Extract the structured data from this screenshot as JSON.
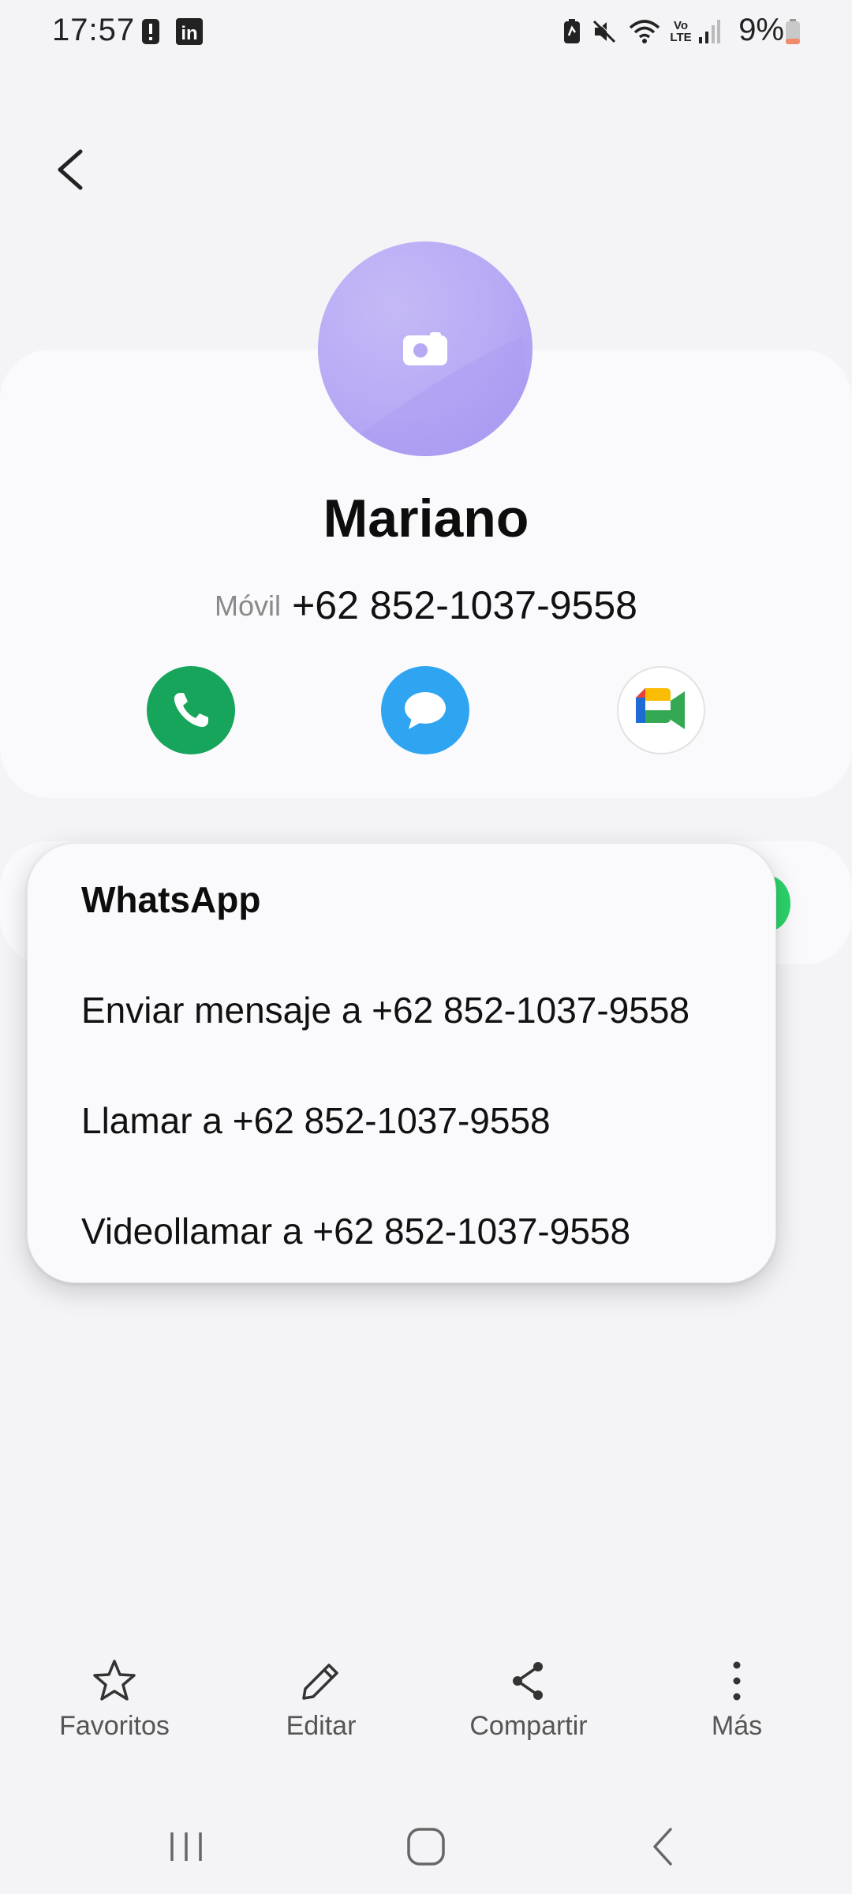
{
  "status_bar": {
    "time": "17:57",
    "battery": "9%",
    "left_icons": [
      "alert-icon",
      "linkedin-icon"
    ],
    "right_icons": [
      "battery-saver-icon",
      "mute-icon",
      "wifi-icon",
      "volte-icon",
      "signal-icon",
      "battery-icon"
    ],
    "volte_top": "Vo",
    "volte_bottom": "LTE",
    "linkedin": "in"
  },
  "contact": {
    "name": "Mariano",
    "phone_type": "Móvil",
    "phone": "+62 852-1037-9558",
    "avatar_color": "#b8a9f5"
  },
  "actions": {
    "call_color": "#16a55a",
    "message_color": "#2fa5f2"
  },
  "popup": {
    "title": "WhatsApp",
    "items": [
      "Enviar mensaje a +62 852-1037-9558",
      "Llamar a +62 852-1037-9558",
      "Videollamar a +62 852-1037-9558"
    ]
  },
  "bottom_bar": {
    "items": [
      {
        "label": "Favoritos",
        "icon": "star-icon"
      },
      {
        "label": "Editar",
        "icon": "pencil-icon"
      },
      {
        "label": "Compartir",
        "icon": "share-icon"
      },
      {
        "label": "Más",
        "icon": "more-icon"
      }
    ]
  },
  "nav_bar": {
    "icons": [
      "recents-icon",
      "home-icon",
      "back-icon"
    ]
  }
}
